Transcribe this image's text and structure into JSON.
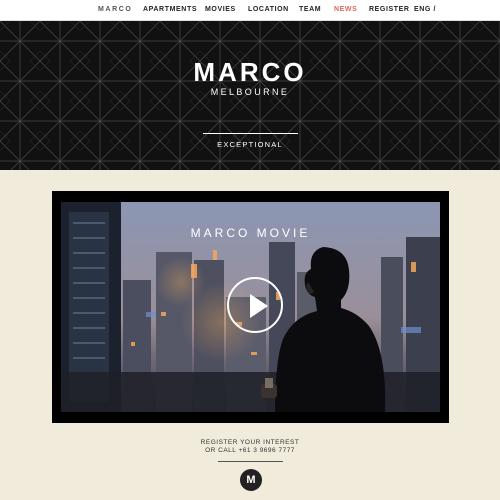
{
  "nav": {
    "logo": "MARCO",
    "items": [
      {
        "label": "APARTMENTS"
      },
      {
        "label": "MOVIES"
      },
      {
        "label": "LOCATION"
      },
      {
        "label": "TEAM"
      },
      {
        "label": "NEWS",
        "active": true
      },
      {
        "label": "REGISTER"
      },
      {
        "label": "ENG /"
      }
    ]
  },
  "hero": {
    "title": "MARCO",
    "subtitle": "MELBOURNE",
    "tagline": "EXCEPTIONAL"
  },
  "video": {
    "title": "MARCO MOVIE",
    "play_icon": "play-icon"
  },
  "footer": {
    "cta_line1": "REGISTER YOUR INTEREST",
    "cta_line2": "OR CALL +61 3 9696 7777",
    "logo_glyph": "M"
  },
  "colors": {
    "accent": "#e3645b",
    "background": "#f1ebdc",
    "hero": "#111111"
  }
}
